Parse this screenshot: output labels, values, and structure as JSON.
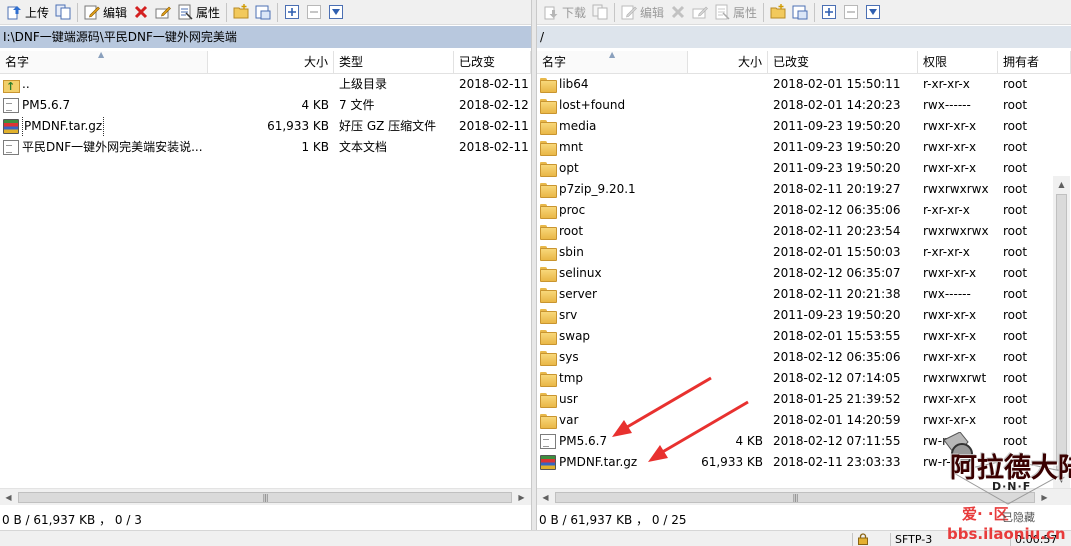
{
  "left_toolbar": {
    "upload_label": "上传",
    "edit_label": "编辑",
    "properties_label": "属性"
  },
  "right_toolbar": {
    "download_label": "下载",
    "edit_label": "编辑",
    "properties_label": "属性"
  },
  "left_panel": {
    "path": "I:\\DNF一键端源码\\平民DNF一键外网完美端",
    "columns": {
      "name": "名字",
      "size": "大小",
      "type": "类型",
      "modified": "已改变"
    },
    "files": [
      {
        "icon": "up-folder-icon",
        "name": "..",
        "size": "",
        "type": "上级目录",
        "modified": "2018-02-11"
      },
      {
        "icon": "file-icon",
        "name": "PM5.6.7",
        "size": "4 KB",
        "type": "7 文件",
        "modified": "2018-02-12"
      },
      {
        "icon": "archive-icon",
        "name": "PMDNF.tar.gz",
        "size": "61,933 KB",
        "type": "好压 GZ 压缩文件",
        "modified": "2018-02-11"
      },
      {
        "icon": "text-file-icon",
        "name": "平民DNF一键外网完美端安装说...",
        "size": "1 KB",
        "type": "文本文档",
        "modified": "2018-02-11"
      }
    ],
    "status": "0 B / 61,937 KB ， 0 / 3"
  },
  "right_panel": {
    "path": "/",
    "columns": {
      "name": "名字",
      "size": "大小",
      "modified": "已改变",
      "permissions": "权限",
      "owner": "拥有者"
    },
    "files": [
      {
        "icon": "folder-icon",
        "name": "lib64",
        "size": "",
        "modified": "2018-02-01 15:50:11",
        "permissions": "r-xr-xr-x",
        "owner": "root"
      },
      {
        "icon": "folder-icon",
        "name": "lost+found",
        "size": "",
        "modified": "2018-02-01 14:20:23",
        "permissions": "rwx------",
        "owner": "root"
      },
      {
        "icon": "folder-icon",
        "name": "media",
        "size": "",
        "modified": "2011-09-23 19:50:20",
        "permissions": "rwxr-xr-x",
        "owner": "root"
      },
      {
        "icon": "folder-icon",
        "name": "mnt",
        "size": "",
        "modified": "2011-09-23 19:50:20",
        "permissions": "rwxr-xr-x",
        "owner": "root"
      },
      {
        "icon": "folder-icon",
        "name": "opt",
        "size": "",
        "modified": "2011-09-23 19:50:20",
        "permissions": "rwxr-xr-x",
        "owner": "root"
      },
      {
        "icon": "folder-icon",
        "name": "p7zip_9.20.1",
        "size": "",
        "modified": "2018-02-11 20:19:27",
        "permissions": "rwxrwxrwx",
        "owner": "root"
      },
      {
        "icon": "folder-icon",
        "name": "proc",
        "size": "",
        "modified": "2018-02-12 06:35:06",
        "permissions": "r-xr-xr-x",
        "owner": "root"
      },
      {
        "icon": "folder-icon",
        "name": "root",
        "size": "",
        "modified": "2018-02-11 20:23:54",
        "permissions": "rwxrwxrwx",
        "owner": "root"
      },
      {
        "icon": "folder-icon",
        "name": "sbin",
        "size": "",
        "modified": "2018-02-01 15:50:03",
        "permissions": "r-xr-xr-x",
        "owner": "root"
      },
      {
        "icon": "folder-icon",
        "name": "selinux",
        "size": "",
        "modified": "2018-02-12 06:35:07",
        "permissions": "rwxr-xr-x",
        "owner": "root"
      },
      {
        "icon": "folder-icon",
        "name": "server",
        "size": "",
        "modified": "2018-02-11 20:21:38",
        "permissions": "rwx------",
        "owner": "root"
      },
      {
        "icon": "folder-icon",
        "name": "srv",
        "size": "",
        "modified": "2011-09-23 19:50:20",
        "permissions": "rwxr-xr-x",
        "owner": "root"
      },
      {
        "icon": "folder-icon",
        "name": "swap",
        "size": "",
        "modified": "2018-02-01 15:53:55",
        "permissions": "rwxr-xr-x",
        "owner": "root"
      },
      {
        "icon": "folder-icon",
        "name": "sys",
        "size": "",
        "modified": "2018-02-12 06:35:06",
        "permissions": "rwxr-xr-x",
        "owner": "root"
      },
      {
        "icon": "folder-icon",
        "name": "tmp",
        "size": "",
        "modified": "2018-02-12 07:14:05",
        "permissions": "rwxrwxrwt",
        "owner": "root"
      },
      {
        "icon": "folder-icon",
        "name": "usr",
        "size": "",
        "modified": "2018-01-25 21:39:52",
        "permissions": "rwxr-xr-x",
        "owner": "root"
      },
      {
        "icon": "folder-icon",
        "name": "var",
        "size": "",
        "modified": "2018-02-01 14:20:59",
        "permissions": "rwxr-xr-x",
        "owner": "root"
      },
      {
        "icon": "file-icon",
        "name": "PM5.6.7",
        "size": "4 KB",
        "modified": "2018-02-12 07:11:55",
        "permissions": "rw-r--r--",
        "owner": "root"
      },
      {
        "icon": "archive-icon",
        "name": "PMDNF.tar.gz",
        "size": "61,933 KB",
        "modified": "2018-02-11 23:03:33",
        "permissions": "rw-r--",
        "owner": ""
      }
    ],
    "status": "0 B / 61,937 KB ， 0 / 25"
  },
  "bottom_status": {
    "protocol": "SFTP-3",
    "time": "0:00:57"
  },
  "watermark": {
    "logo_text": "阿拉德大陆",
    "logo_sub": "D·N·F",
    "site_text": "爱·   ·区",
    "url_text": "bbs.ilaoniu.cn",
    "hidden_label": "已隐藏"
  },
  "colors": {
    "left_path_bg": "#b8c8de",
    "right_path_bg": "#dde4ec",
    "annotation_arrow": "#e8312f",
    "folder": "#f2c95c"
  }
}
